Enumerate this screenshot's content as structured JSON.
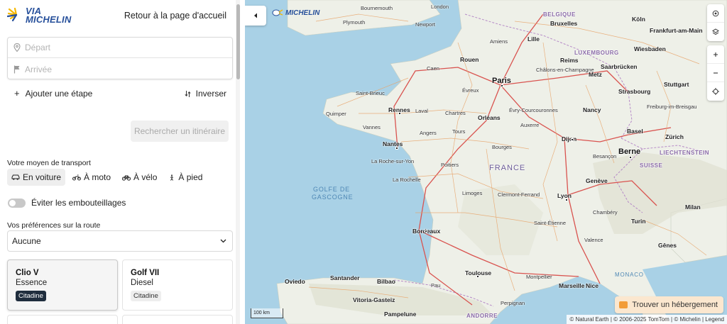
{
  "brand": {
    "line1": "VIA",
    "line2": "MICHELIN",
    "map_logo": "MICHELIN"
  },
  "header": {
    "back_link": "Retour à la page d'accueil"
  },
  "route": {
    "departure_placeholder": "Départ",
    "arrival_placeholder": "Arrivée",
    "departure_value": "",
    "arrival_value": ""
  },
  "actions": {
    "add_step": "Ajouter une étape",
    "invert": "Inverser",
    "search": "Rechercher un itinéraire"
  },
  "transport": {
    "label": "Votre moyen de transport",
    "modes": [
      {
        "label": "En voiture",
        "icon": "car-icon",
        "active": true
      },
      {
        "label": "À moto",
        "icon": "motorbike-icon",
        "active": false
      },
      {
        "label": "À vélo",
        "icon": "bicycle-icon",
        "active": false
      },
      {
        "label": "À pied",
        "icon": "pedestrian-icon",
        "active": false
      }
    ]
  },
  "traffic": {
    "label": "Éviter les embouteillages",
    "enabled": false
  },
  "preferences": {
    "label": "Vos préférences sur la route",
    "selected": "Aucune"
  },
  "vehicles": [
    {
      "name": "Clio V",
      "fuel": "Essence",
      "tag": "Citadine",
      "selected": true
    },
    {
      "name": "Golf VII",
      "fuel": "Diesel",
      "tag": "Citadine",
      "selected": false
    }
  ],
  "map": {
    "lodging_button": "Trouver un hébergement",
    "scale": "100 km",
    "attribution": "© Natural Earth | © 2006-2025 TomTom | © Michelin | Legend",
    "colors": {
      "sea": "#a9d1e6",
      "land": "#eef0e8",
      "road": "#e8a46a",
      "highway": "#d9534f",
      "brand": "#27509b"
    },
    "labels": {
      "bournemouth": "Bournemouth",
      "london": "London",
      "plymouth": "Plymouth",
      "newport": "Newport",
      "belgique": "BELGIQUE",
      "bruxelles": "Bruxelles",
      "koln": "Köln",
      "frankfurt": "Frankfurt-am-Main",
      "amiens": "Amiens",
      "lille": "Lille",
      "luxembourg": "LUXEMBOURG",
      "wiesbaden": "Wiesbaden",
      "rouen": "Rouen",
      "caen": "Caen",
      "paris": "Paris",
      "reims": "Reims",
      "chalons": "Châlons-en-Champagne",
      "metz": "Metz",
      "saarbrucken": "Saarbrücken",
      "stuttgart": "Stuttgart",
      "strasbourg": "Strasbourg",
      "freiburg": "Freiburg-im-Breisgau",
      "saint_brieuc": "Saint-Brieuc",
      "evreux": "Évreux",
      "rennes": "Rennes",
      "laval": "Laval",
      "quimper": "Quimper",
      "chartres": "Chartres",
      "evry": "Évry-Courcouronnes",
      "orleans": "Orléans",
      "auxerre": "Auxerre",
      "nancy": "Nancy",
      "vannes": "Vannes",
      "angers": "Angers",
      "tours": "Tours",
      "nantes": "Nantes",
      "dijon": "Dijon",
      "basel": "Basel",
      "zurich": "Zürich",
      "bourges": "Bourges",
      "besancon": "Besançon",
      "bern": "Berne",
      "liechtenstein": "LIECHTENSTEIN",
      "la_roche": "La Roche-sur-Yon",
      "france": "FRANCE",
      "suisse": "SUISSE",
      "poitiers": "Poitiers",
      "geneve": "Genève",
      "la_rochelle": "La Rochelle",
      "golfe1": "GOLFE DE",
      "golfe2": "GASCOGNE",
      "limoges": "Limoges",
      "clermont": "Clermont-Ferrand",
      "lyon": "Lyon",
      "milan": "Milan",
      "chambery": "Chambéry",
      "turin": "Turin",
      "bordeaux": "Bordeaux",
      "saint_etienne": "Saint-Étienne",
      "valence": "Valence",
      "genes": "Gênes",
      "monaco": "MONACO",
      "toulouse": "Toulouse",
      "santander": "Santander",
      "bilbao": "Bilbao",
      "oviedo": "Oviedo",
      "pau": "Pau",
      "montpellier": "Montpellier",
      "marseille": "Marseille",
      "nice": "Nice",
      "vitoria": "Vitoria-Gasteiz",
      "pamplona": "Pampelune",
      "andorre": "ANDORRE",
      "perpignan": "Perpignan"
    }
  }
}
